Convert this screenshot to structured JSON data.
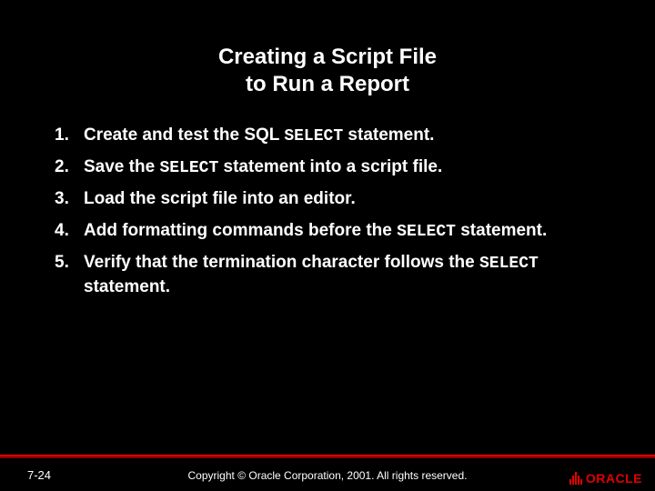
{
  "title_line1": "Creating a Script File",
  "title_line2": "to Run a Report",
  "steps": {
    "s1a": "Create and test the SQL ",
    "s1b": "SELECT",
    "s1c": " statement.",
    "s2a": "Save the ",
    "s2b": "SELECT",
    "s2c": " statement into a script file.",
    "s3": "Load the script file into an editor.",
    "s4a": "Add formatting commands before the ",
    "s4b": "SELECT",
    "s4c": " statement.",
    "s5a": "Verify that the termination character follows the ",
    "s5b": "SELECT",
    "s5c": " statement."
  },
  "footer": {
    "page": "7-24",
    "copyright": "Copyright © Oracle Corporation, 2001. All rights reserved.",
    "logo_text": "ORACLE"
  }
}
